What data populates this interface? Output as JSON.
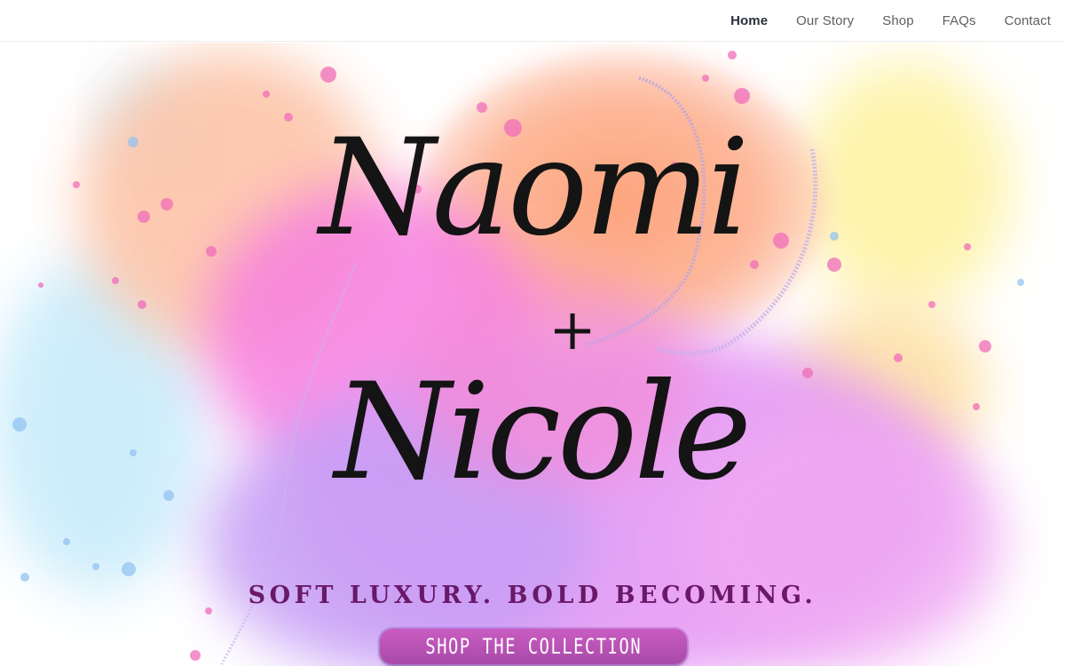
{
  "nav": {
    "items": [
      {
        "label": "Home",
        "active": true
      },
      {
        "label": "Our Story",
        "active": false
      },
      {
        "label": "Shop",
        "active": false
      },
      {
        "label": "FAQs",
        "active": false
      },
      {
        "label": "Contact",
        "active": false
      }
    ]
  },
  "hero": {
    "logo_line1": "Naomi",
    "logo_plus": "+",
    "logo_line2": "Nicole",
    "tagline": "SOFT LUXURY. BOLD BECOMING.",
    "cta_label": "SHOP THE COLLECTION"
  },
  "colors": {
    "tagline": "#6a1868",
    "cta_bg": "#b64fb3",
    "nav_active": "#2a2f3a",
    "nav_text": "#5f5f5f"
  }
}
